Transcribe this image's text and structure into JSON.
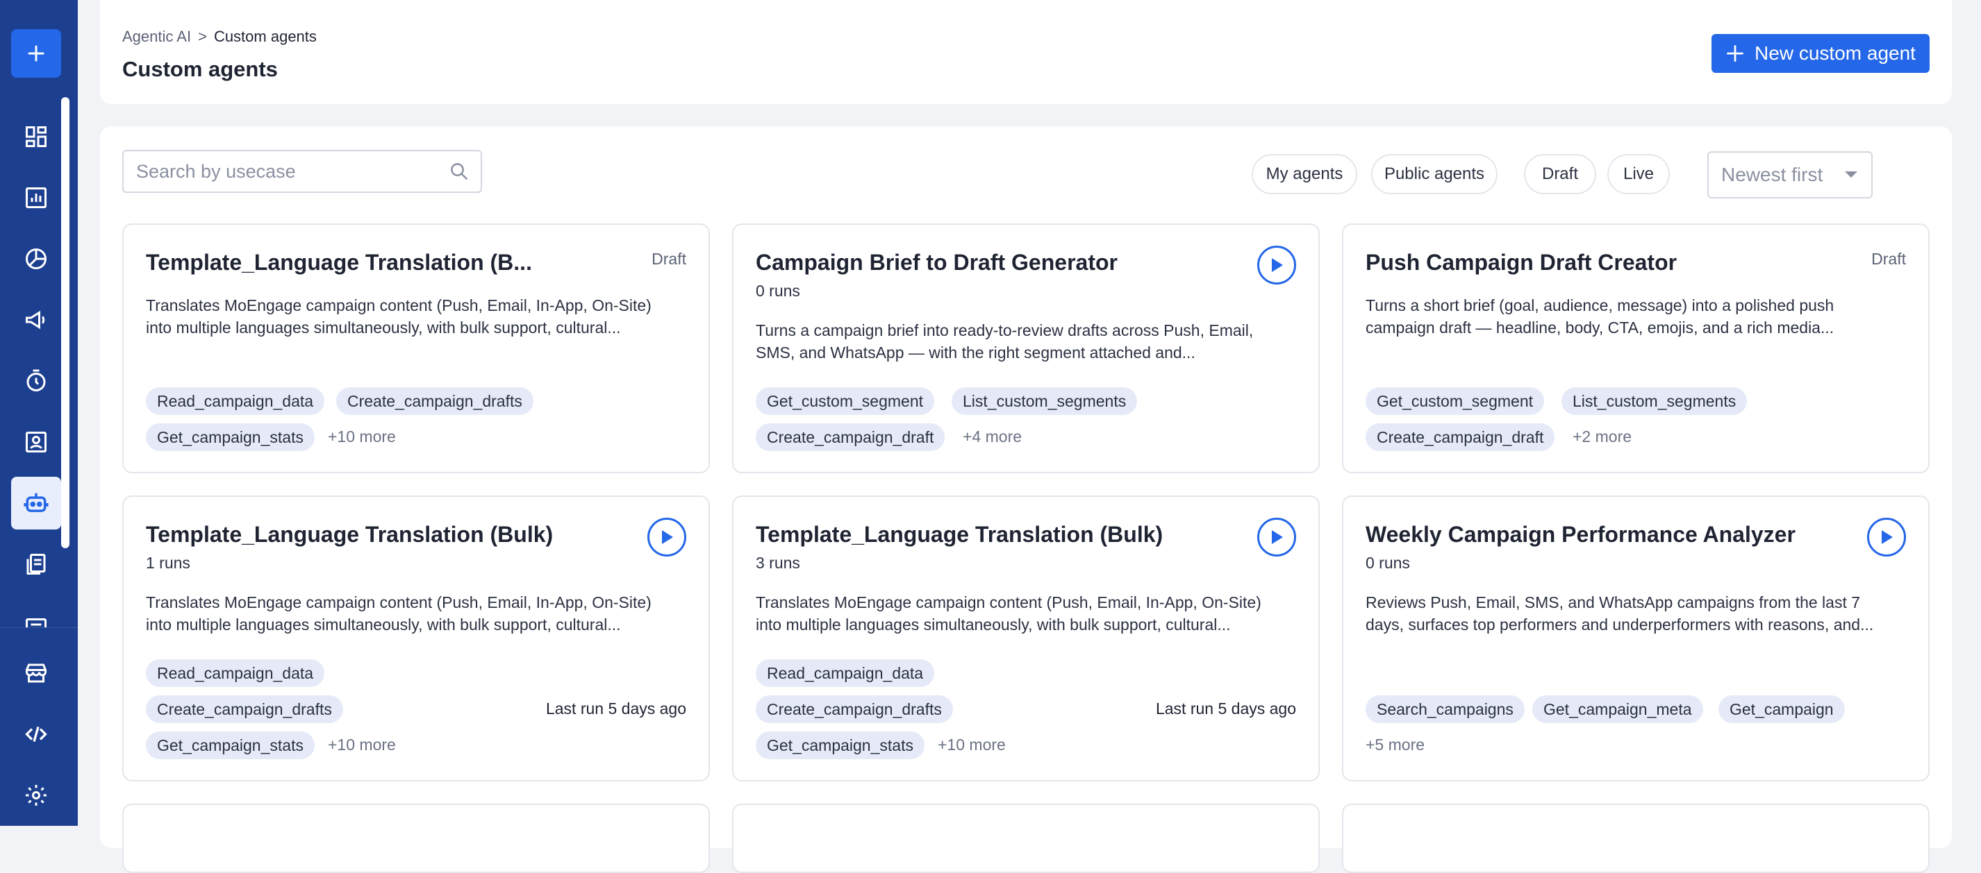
{
  "breadcrumb": {
    "parent": "Agentic AI",
    "separator": ">",
    "current": "Custom agents"
  },
  "page_title": "Custom agents",
  "new_agent_button": {
    "icon": "plus-icon",
    "label": "New custom agent"
  },
  "search": {
    "placeholder": "Search by usecase",
    "value": ""
  },
  "filters": [
    "My agents",
    "Public agents",
    "Draft",
    "Live"
  ],
  "sort": {
    "selected": "Newest first"
  },
  "sidebar": {
    "icons": [
      "plus-icon",
      "dashboard-icon",
      "analytics-icon",
      "segment-icon",
      "megaphone-icon",
      "timer-icon",
      "user-card-icon",
      "robot-icon",
      "documents-icon",
      "partial-icon",
      "store-icon",
      "code-icon",
      "gear-icon"
    ],
    "active": "robot-icon"
  },
  "agents": [
    {
      "title": "Template_Language Translation (B...",
      "status": "Draft",
      "runs": "",
      "description_1": "Translates MoEngage campaign content (Push, Email, In-App, On-Site)",
      "description_2": "into multiple languages simultaneously, with bulk support, cultural...",
      "tags": [
        "Read_campaign_data",
        "Create_campaign_drafts",
        "Get_campaign_stats"
      ],
      "more": "+10 more",
      "last_run": ""
    },
    {
      "title": "Campaign Brief to Draft Generator",
      "status": "",
      "runs": "0 runs",
      "description_1": "Turns a campaign brief into ready-to-review drafts across Push, Email,",
      "description_2": "SMS, and WhatsApp — with the right segment attached and...",
      "tags": [
        "Get_custom_segment",
        "List_custom_segments",
        "Create_campaign_draft"
      ],
      "more": "+4 more",
      "last_run": ""
    },
    {
      "title": "Push Campaign Draft Creator",
      "status": "Draft",
      "runs": "",
      "description_1": "Turns a short brief (goal, audience, message) into a polished push",
      "description_2": "campaign draft — headline, body, CTA, emojis, and a rich media...",
      "tags": [
        "Get_custom_segment",
        "List_custom_segments",
        "Create_campaign_draft"
      ],
      "more": "+2 more",
      "last_run": ""
    },
    {
      "title": "Template_Language Translation (Bulk)",
      "status": "",
      "runs": "1 runs",
      "description_1": "Translates MoEngage campaign content (Push, Email, In-App, On-Site)",
      "description_2": "into multiple languages simultaneously, with bulk support, cultural...",
      "tags": [
        "Read_campaign_data",
        "Create_campaign_drafts",
        "Get_campaign_stats"
      ],
      "more": "+10 more",
      "last_run": "Last run 5 days ago"
    },
    {
      "title": "Template_Language Translation (Bulk)",
      "status": "",
      "runs": "3 runs",
      "description_1": "Translates MoEngage campaign content (Push, Email, In-App, On-Site)",
      "description_2": "into multiple languages simultaneously, with bulk support, cultural...",
      "tags": [
        "Read_campaign_data",
        "Create_campaign_drafts",
        "Get_campaign_stats"
      ],
      "more": "+10 more",
      "last_run": "Last run 5 days ago"
    },
    {
      "title": "Weekly Campaign Performance Analyzer",
      "status": "",
      "runs": "0 runs",
      "description_1": "Reviews Push, Email, SMS, and WhatsApp campaigns from the last 7",
      "description_2": "days, surfaces top performers and underperformers with reasons, and...",
      "tags": [
        "Search_campaigns",
        "Get_campaign_meta",
        "Get_campaign"
      ],
      "more": "+5 more",
      "last_run": ""
    }
  ],
  "colors": {
    "sidebar": "#1d3f8f",
    "accent": "#2467e8",
    "tag_bg": "#e6eaf8",
    "page_bg": "#f2f3f6"
  }
}
